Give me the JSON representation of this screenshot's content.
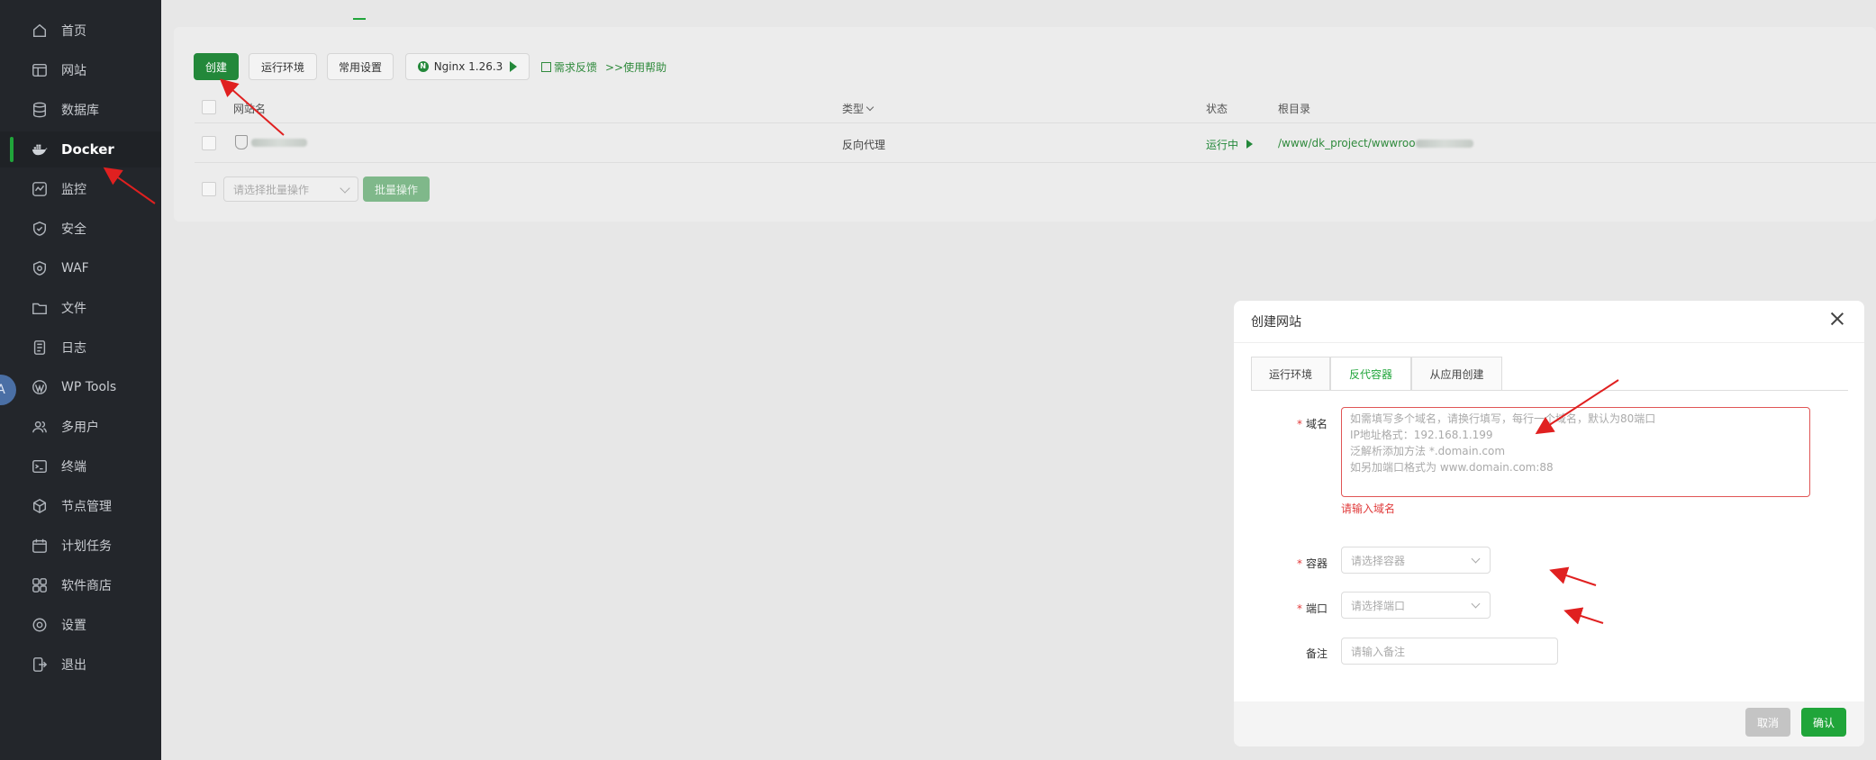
{
  "sidebar": {
    "items": [
      {
        "label": "首页",
        "icon": "home-icon"
      },
      {
        "label": "网站",
        "icon": "website-icon"
      },
      {
        "label": "数据库",
        "icon": "database-icon"
      },
      {
        "label": "Docker",
        "icon": "docker-icon",
        "active": true
      },
      {
        "label": "监控",
        "icon": "monitor-icon"
      },
      {
        "label": "安全",
        "icon": "shield-icon"
      },
      {
        "label": "WAF",
        "icon": "waf-icon"
      },
      {
        "label": "文件",
        "icon": "folder-icon"
      },
      {
        "label": "日志",
        "icon": "log-icon"
      },
      {
        "label": "WP Tools",
        "icon": "wordpress-icon"
      },
      {
        "label": "多用户",
        "icon": "users-icon"
      },
      {
        "label": "终端",
        "icon": "terminal-icon"
      },
      {
        "label": "节点管理",
        "icon": "node-icon"
      },
      {
        "label": "计划任务",
        "icon": "calendar-icon"
      },
      {
        "label": "软件商店",
        "icon": "store-icon"
      },
      {
        "label": "设置",
        "icon": "settings-icon"
      },
      {
        "label": "退出",
        "icon": "logout-icon"
      }
    ],
    "avatar_letter": "A"
  },
  "toolbar": {
    "create": "创建",
    "runtime_env": "运行环境",
    "common_settings": "常用设置",
    "nginx": "Nginx 1.26.3",
    "feedback": "需求反馈",
    "help": ">>使用帮助"
  },
  "table": {
    "headers": {
      "name": "网站名",
      "type": "类型",
      "status": "状态",
      "root": "根目录"
    },
    "rows": [
      {
        "type": "反向代理",
        "status": "运行中",
        "root": "/www/dk_project/wwwroo"
      }
    ]
  },
  "batch": {
    "placeholder": "请选择批量操作",
    "button": "批量操作"
  },
  "dialog": {
    "title": "创建网站",
    "tabs": [
      "运行环境",
      "反代容器",
      "从应用创建"
    ],
    "active_tab": 1,
    "fields": {
      "domain_label": "域名",
      "domain_placeholder": "如需填写多个域名，请换行填写，每行一个域名，默认为80端口\nIP地址格式：192.168.1.199\n泛解析添加方法 *.domain.com\n如另加端口格式为 www.domain.com:88",
      "domain_error": "请输入域名",
      "container_label": "容器",
      "container_placeholder": "请选择容器",
      "port_label": "端口",
      "port_placeholder": "请选择端口",
      "note_label": "备注",
      "note_placeholder": "请输入备注"
    },
    "cancel": "取消",
    "confirm": "确认"
  },
  "colors": {
    "accent": "#20a53a",
    "sidebar_bg": "#23262b",
    "error": "#e03b3b",
    "annotation": "#e02020"
  }
}
